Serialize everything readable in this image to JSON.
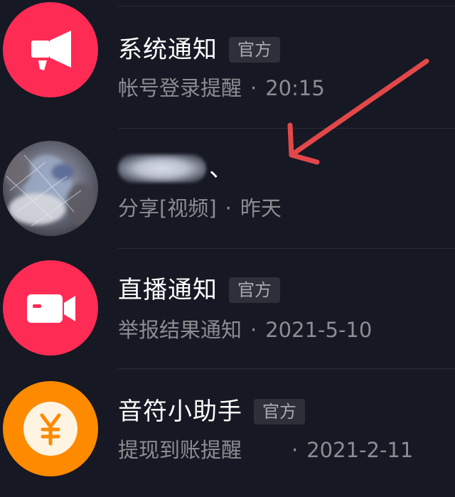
{
  "colors": {
    "background": "#161823",
    "accent_pink": "#fe2c55",
    "accent_orange": "#fe8a00",
    "annotation_red": "#e2484a"
  },
  "rows": [
    {
      "title": "系统通知",
      "badge": "官方",
      "preview": "帐号登录提醒",
      "dot": "·",
      "time": "20:15",
      "icon": "megaphone-icon"
    },
    {
      "title_suffix": "、",
      "preview": "分享[视频]",
      "dot": "·",
      "time": "昨天",
      "icon": "user-avatar"
    },
    {
      "title": "直播通知",
      "badge": "官方",
      "preview": "举报结果通知",
      "dot": "·",
      "time": "2021-5-10",
      "icon": "video-camera-icon"
    },
    {
      "title": "音符小助手",
      "badge": "官方",
      "preview": "提现到账提醒",
      "dot": "·",
      "time": "2021-2-11",
      "icon": "yuan-coin-icon"
    }
  ]
}
